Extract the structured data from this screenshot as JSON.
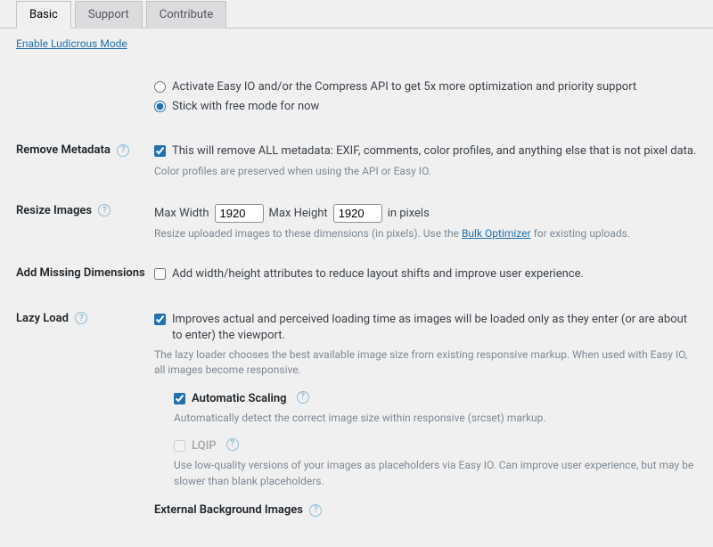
{
  "tabs": {
    "basic": "Basic",
    "support": "Support",
    "contribute": "Contribute"
  },
  "ludicrous_link": "Enable Ludicrous Mode",
  "top_options": {
    "activate": "Activate Easy IO and/or the Compress API to get 5x more optimization and priority support",
    "stick": "Stick with free mode for now"
  },
  "rows": {
    "metadata": {
      "label": "Remove Metadata",
      "check": "This will remove ALL metadata: EXIF, comments, color profiles, and anything else that is not pixel data.",
      "desc": "Color profiles are preserved when using the API or Easy IO."
    },
    "resize": {
      "label": "Resize Images",
      "max_width_label": "Max Width",
      "max_width_value": "1920",
      "max_height_label": "Max Height",
      "max_height_value": "1920",
      "unit": "in pixels",
      "desc_pre": "Resize uploaded images to these dimensions (in pixels). Use the ",
      "desc_link": "Bulk Optimizer",
      "desc_post": " for existing uploads."
    },
    "dims": {
      "label": "Add Missing Dimensions",
      "check": "Add width/height attributes to reduce layout shifts and improve user experience."
    },
    "lazy": {
      "label": "Lazy Load",
      "check": "Improves actual and perceived loading time as images will be loaded only as they enter (or are about to enter) the viewport.",
      "desc": "The lazy loader chooses the best available image size from existing responsive markup. When used with Easy IO, all images become responsive.",
      "auto_scaling_label": "Automatic Scaling",
      "auto_scaling_desc": "Automatically detect the correct image size within responsive (srcset) markup.",
      "lqip_label": "LQIP",
      "lqip_desc": "Use low-quality versions of your images as placeholders via Easy IO. Can improve user experience, but may be slower than blank placeholders.",
      "ext_bg": "External Background Images"
    }
  }
}
